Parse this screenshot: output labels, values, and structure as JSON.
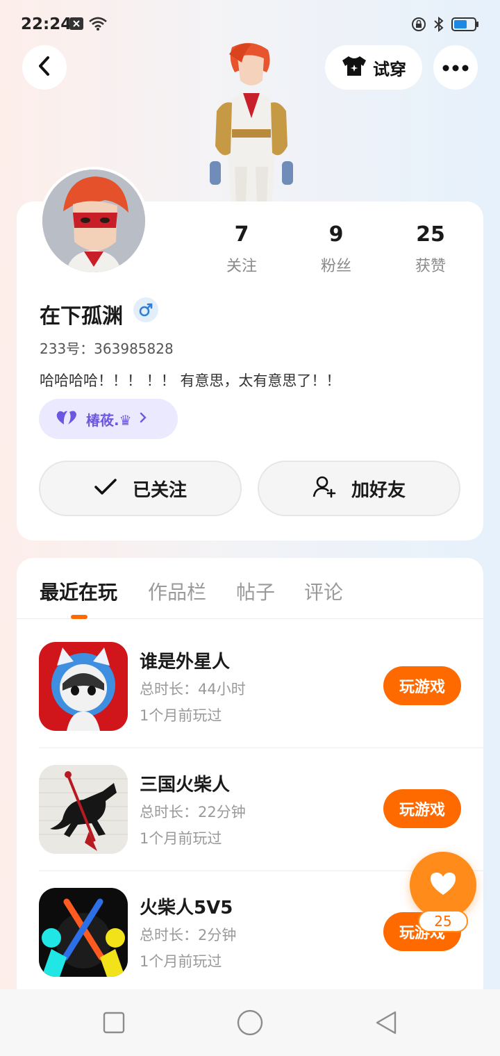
{
  "status_bar": {
    "time": "22:24",
    "left_icons": [
      "message-notification-icon",
      "wifi-icon"
    ],
    "right_icons": [
      "rotation-lock-icon",
      "bluetooth-icon",
      "battery-icon"
    ]
  },
  "header": {
    "back_icon": "chevron-left-icon",
    "tryon_label": "试穿",
    "tryon_icon": "tshirt-icon",
    "more_icon": "more-horizontal-icon"
  },
  "profile": {
    "nickname": "在下孤渊",
    "gender_icon": "male-icon",
    "uid": "233号：363985828",
    "bio": "哈哈哈哈！！！ ！！ 有意思，太有意思了！！",
    "stats": [
      {
        "value": "7",
        "label": "关注"
      },
      {
        "value": "9",
        "label": "粉丝"
      },
      {
        "value": "25",
        "label": "获赞"
      }
    ],
    "club": {
      "name": "椿莜.♛",
      "icon": "heart-pair-icon"
    },
    "actions": {
      "follow_label": "已关注",
      "add_friend_label": "加好友"
    }
  },
  "tabs": [
    {
      "label": "最近在玩",
      "active": true
    },
    {
      "label": "作品栏",
      "active": false
    },
    {
      "label": "帖子",
      "active": false
    },
    {
      "label": "评论",
      "active": false
    }
  ],
  "games": [
    {
      "title": "谁是外星人",
      "duration": "总时长：44小时",
      "last_played": "1个月前玩过",
      "play_label": "玩游戏"
    },
    {
      "title": "三国火柴人",
      "duration": "总时长：22分钟",
      "last_played": "1个月前玩过",
      "play_label": "玩游戏"
    },
    {
      "title": "火柴人5V5",
      "duration": "总时长：2分钟",
      "last_played": "1个月前玩过",
      "play_label": "玩游戏"
    }
  ],
  "like_fab": {
    "count": "25",
    "icon": "heart-icon"
  },
  "nav": [
    "recent-apps-icon",
    "home-icon",
    "back-triangle-icon"
  ],
  "colors": {
    "accent": "#ff6a00",
    "fab": "#ff8c1a",
    "club_text": "#6c58e0"
  }
}
